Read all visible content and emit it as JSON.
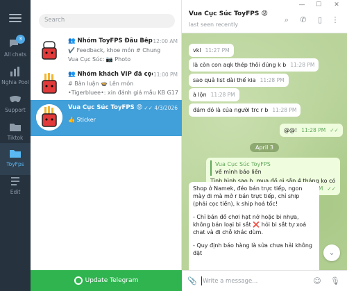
{
  "window": {
    "minimize": "—",
    "maximize": "☐",
    "close": "✕"
  },
  "rail": {
    "folders": [
      {
        "label": "All chats",
        "badge": "3",
        "icon": "chat-bubbles-icon"
      },
      {
        "label": "Nghia Pool",
        "icon": "stats-icon"
      },
      {
        "label": "Support",
        "icon": "mask-icon"
      },
      {
        "label": "Tiktok",
        "icon": "folder-icon"
      },
      {
        "label": "ToyFps",
        "icon": "folder-icon"
      },
      {
        "label": "Edit",
        "icon": "edit-icon"
      }
    ]
  },
  "search": {
    "placeholder": "Search"
  },
  "chats": [
    {
      "title": "Nhóm ToyFPS Đầu Bếp Cục S...",
      "time": "12:00 AM",
      "line1": "✔️ Feedback, khoe món # Chung",
      "line2": "Vua Cục Súc: 📷 Photo"
    },
    {
      "title": "Nhóm khách VIP đã cọc, đã ...",
      "time": "11:00 PM",
      "line1": "# Bàn luận 🍲 Lên món",
      "line2": "•Tigerbluee•: xin đánh giá mẫu KB G17 ebb..."
    },
    {
      "title": "Vua Cục Súc ToyFPS 😡",
      "time": "4/3/2026",
      "line1": "👍 Sticker",
      "line2": ""
    }
  ],
  "update_button": "Update Telegram",
  "header": {
    "title": "Vua Cục Súc ToyFPS 😡",
    "status": "last seen recently"
  },
  "messages": [
    {
      "text": "vkl",
      "time": "11:27 PM"
    },
    {
      "text": "là còn con aqk thép thôi đúng k b",
      "time": "11:28 PM"
    },
    {
      "text": "sao quả list dài thế kia",
      "time": "11:28 PM"
    },
    {
      "text": "à lộn",
      "time": "11:28 PM"
    },
    {
      "text": "đám đó là của người trc r b",
      "time": "11:28 PM"
    },
    {
      "text": "@@!",
      "time": "11:28 PM"
    }
  ],
  "date_separator": "April 3",
  "reply_msg": {
    "reply_name": "Vua Cục Súc ToyFPS",
    "reply_text": "về mình báo liền",
    "text": "Tình hình sao b, mua đồ gì sắp 4 tháng ko có",
    "time": "8:31 PM"
  },
  "long_msg": {
    "p1": "Shop ở Namek, đéo bán trực tiếp, ngon mày đi mà mở r bán trực tiếp, chỉ ship (phải cọc tiền), k ship hoả tốc!",
    "p2": "- Chỉ bán đồ chơi hạt nở hoặc bi nhựa, không bán loại bi sắt ❌ hỏi bi sắt tự xoá chat và đi chỗ khác dùm.",
    "p3": "- Quy định báo hàng là sửa chưa hải không đặt"
  },
  "composer": {
    "placeholder": "Write a message..."
  }
}
